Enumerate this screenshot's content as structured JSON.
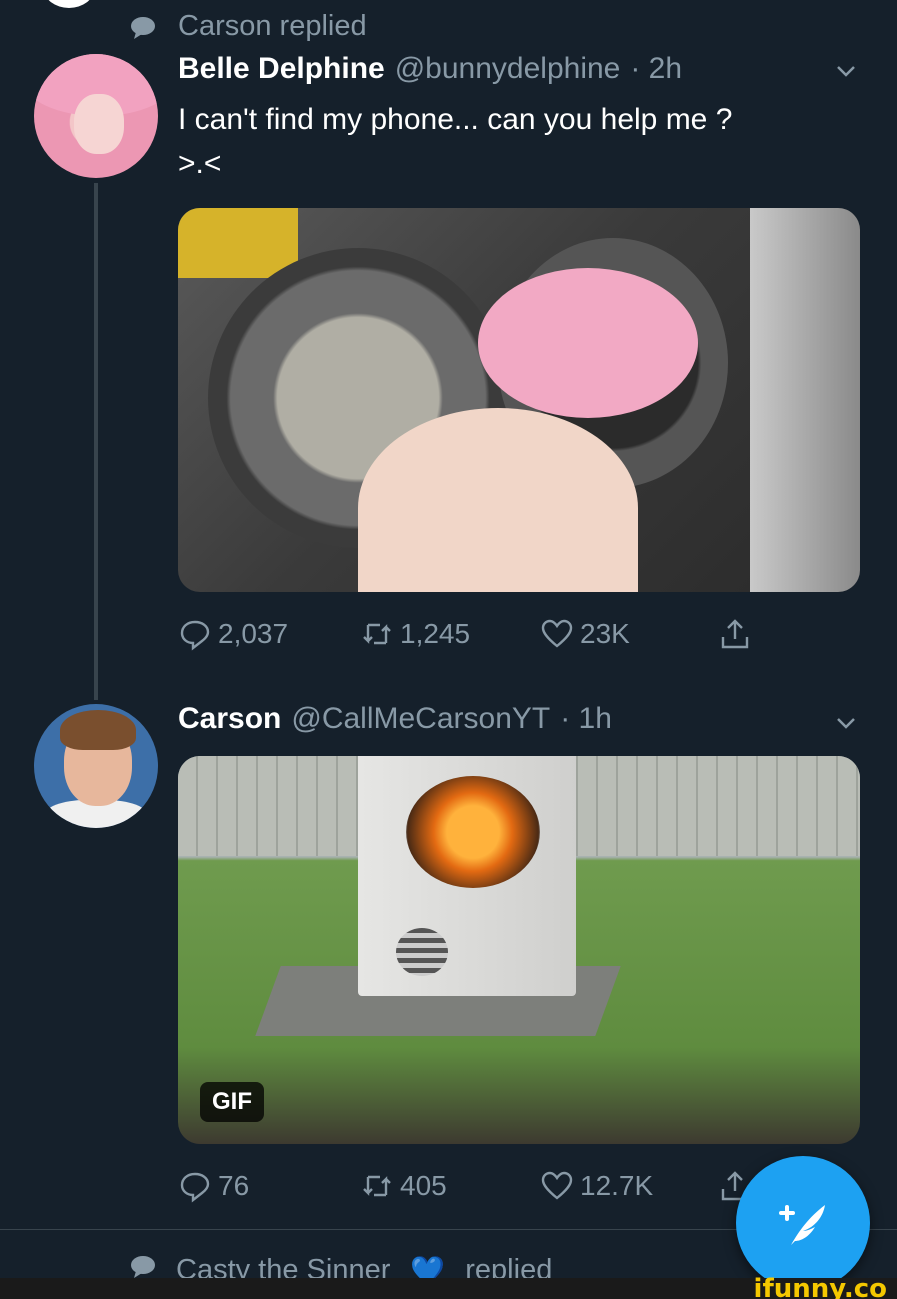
{
  "context_top": {
    "text": "Carson replied"
  },
  "tweet1": {
    "name": "Belle Delphine",
    "handle": "@bunnydelphine",
    "time": "· 2h",
    "text_line1": "I can't find my phone... can you help me ?",
    "text_line2": ">.<",
    "replies": "2,037",
    "retweets": "1,245",
    "likes": "23K"
  },
  "tweet2": {
    "name": "Carson",
    "handle": "@CallMeCarsonYT",
    "time": "· 1h",
    "gif_label": "GIF",
    "replies": "76",
    "retweets": "405",
    "likes": "12.7K"
  },
  "context_bottom": {
    "name": "Casty the Sinner",
    "emoji": "💙",
    "text": "replied"
  },
  "watermark": "ifunny.co",
  "colors": {
    "background": "#15202b",
    "accent": "#1da1f2",
    "muted": "#8899a6"
  }
}
